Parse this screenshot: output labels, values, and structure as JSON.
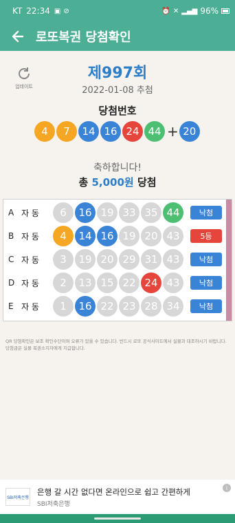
{
  "statusbar": {
    "carrier": "KT",
    "time": "22:34",
    "battery": "96%"
  },
  "appbar": {
    "title": "로또복권 당첨확인"
  },
  "refresh": {
    "label": "업데이트"
  },
  "draw": {
    "round": "제997회",
    "date": "2022-01-08 추첨",
    "label": "당첨번호",
    "numbers": [
      "4",
      "7",
      "14",
      "16",
      "24",
      "44"
    ],
    "bonus": "20",
    "colors": {
      "yellow": "#f5a623",
      "blue": "#3a84d8",
      "red": "#e5453b",
      "green": "#4cbf73",
      "gray": "#d7d7d7",
      "lose_button": "#3a84d8",
      "win_button": "#e5453b"
    }
  },
  "result": {
    "congrats": "축하합니다!",
    "prize_prefix": "총 ",
    "prize_amount": "5,000원",
    "prize_suffix": " 당첨"
  },
  "tickets": [
    {
      "letter": "A",
      "mode": "자 동",
      "numbers": [
        "6",
        "16",
        "19",
        "33",
        "35",
        "44"
      ],
      "hits": [
        false,
        true,
        false,
        false,
        false,
        true
      ],
      "result": "낙첨"
    },
    {
      "letter": "B",
      "mode": "자 동",
      "numbers": [
        "4",
        "14",
        "16",
        "19",
        "20",
        "43"
      ],
      "hits": [
        true,
        true,
        true,
        false,
        false,
        false
      ],
      "result": "5등"
    },
    {
      "letter": "C",
      "mode": "자 동",
      "numbers": [
        "3",
        "19",
        "20",
        "29",
        "31",
        "43"
      ],
      "hits": [
        false,
        false,
        false,
        false,
        false,
        false
      ],
      "result": "낙첨"
    },
    {
      "letter": "D",
      "mode": "자 동",
      "numbers": [
        "2",
        "13",
        "15",
        "22",
        "24",
        "43"
      ],
      "hits": [
        false,
        false,
        false,
        false,
        true,
        false
      ],
      "result": "낙첨"
    },
    {
      "letter": "E",
      "mode": "자 동",
      "numbers": [
        "1",
        "16",
        "22",
        "23",
        "28",
        "34"
      ],
      "hits": [
        false,
        true,
        false,
        false,
        false,
        false
      ],
      "result": "낙첨"
    }
  ],
  "note": "QR 당첨확인은 보조 확인수단이며 오류가 있을 수 있습니다. 반드시 로또 공식사이트에서 실물과 대조하시기 바랍니다. 당첨금은 실물 복권소지자에게 지급합니다.",
  "ad": {
    "headline": "은행 갈 시간 없다면 온라인으로 쉽고 간편하게",
    "advertiser": "SBI저축은행",
    "logo_text": "SBI저축은행",
    "info": "i"
  }
}
